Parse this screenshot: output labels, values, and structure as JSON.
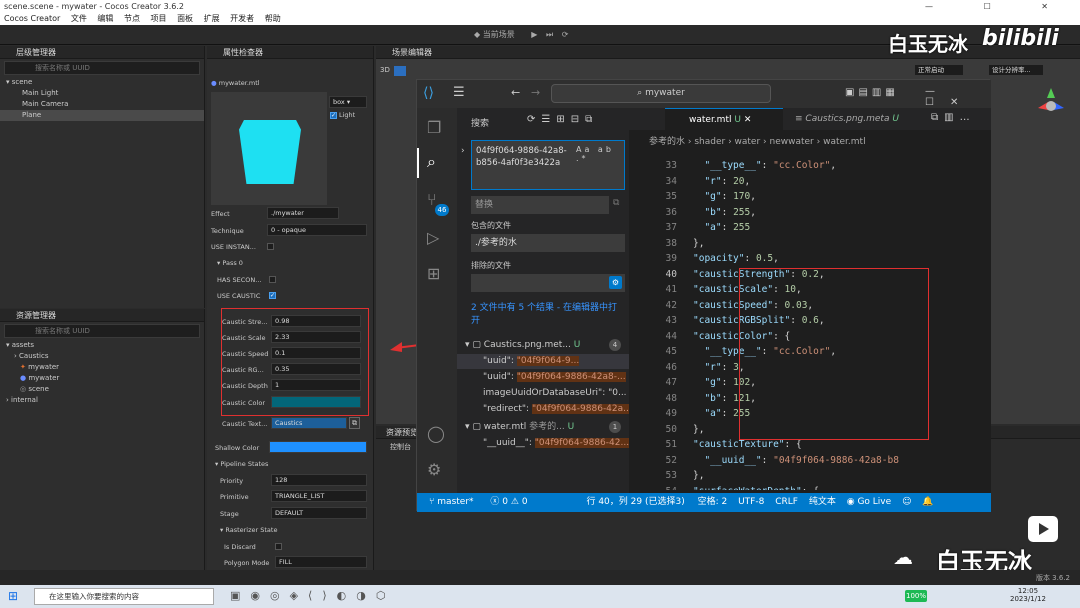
{
  "window": {
    "title": "scene.scene - mywater - Cocos Creator 3.6.2",
    "menu": [
      "Cocos Creator",
      "文件",
      "编辑",
      "节点",
      "项目",
      "面板",
      "扩展",
      "开发者",
      "帮助"
    ],
    "scene_selector": "当前场景"
  },
  "hierarchy": {
    "title": "层级管理器",
    "search_placeholder": "搜索名称或 UUID",
    "items": [
      "scene",
      "Main Light",
      "Main Camera",
      "Plane"
    ]
  },
  "assets": {
    "title": "资源管理器",
    "search_placeholder": "搜索名称或 UUID",
    "items": [
      "assets",
      "Caustics",
      "mywater",
      "mywater",
      "scene",
      "internal"
    ]
  },
  "inspector": {
    "title": "属性检查器",
    "file": "mywater.mtl",
    "preview_shape": "box",
    "light_label": "Light",
    "effect_label": "Effect",
    "effect_value": "./mywater",
    "technique_label": "Technique",
    "technique_value": "0 - opaque",
    "use_instancing": "USE INSTAN...",
    "pass_label": "Pass 0",
    "has_second": "HAS SECON...",
    "use_caustic": "USE CAUSTIC",
    "props": [
      {
        "label": "Caustic Stre...",
        "value": "0.98"
      },
      {
        "label": "Caustic Scale",
        "value": "2.33"
      },
      {
        "label": "Caustic Speed",
        "value": "0.1"
      },
      {
        "label": "Caustic RG...",
        "value": "0.35"
      },
      {
        "label": "Caustic Depth",
        "value": "1"
      },
      {
        "label": "Caustic Color",
        "value": ""
      },
      {
        "label": "Caustic Text...",
        "value": "Caustics"
      }
    ],
    "shallow_color": "Shallow Color",
    "pipeline_states": "Pipeline States",
    "priority_label": "Priority",
    "priority_value": "128",
    "primitive_label": "Primitive",
    "primitive_value": "TRIANGLE_LIST",
    "stage_label": "Stage",
    "stage_value": "DEFAULT",
    "rasterizer": "Rasterizer State",
    "is_discard": "Is Discard",
    "polygon_mode": "Polygon Mode",
    "polygon_value": "FILL"
  },
  "scene_editor": {
    "title": "场景编辑器",
    "mode_3d": "3D",
    "projection": "正常启动",
    "design": "设计分辨率..."
  },
  "console": {
    "title": "资源预览",
    "sub": "控制台"
  },
  "vscode": {
    "search_title": "搜索",
    "search_query": "04f9f064-9886-42a8-b856-4af0f3e3422a",
    "replace_placeholder": "替换",
    "include_label": "包含的文件",
    "include_value": "./参考的水",
    "exclude_label": "排除的文件",
    "result_summary": "2 文件中有 5 个结果 - 在编辑器中打开",
    "address": "mywater",
    "tabs": [
      "water.mtl",
      "Caustics.png.meta"
    ],
    "tab_badges": [
      "U",
      "U"
    ],
    "breadcrumb": [
      "参考的水",
      "shader",
      "water",
      "newwater",
      "water.mtl"
    ],
    "source_control_badge": "46",
    "results": [
      {
        "file": "Caustics.png.met...",
        "badge_letter": "U",
        "count": "4",
        "matches": [
          {
            "key": "\"uuid\": ",
            "value": "\"04f9f064-9..."
          },
          {
            "key": "\"uuid\": ",
            "value": "\"04f9f064-9886-42a8-..."
          },
          {
            "key": "imageUuidOrDatabaseUri\": ",
            "value": "\"0..."
          },
          {
            "key": "\"redirect\": ",
            "value": "\"04f9f064-9886-42a..."
          }
        ]
      },
      {
        "file": "water.mtl",
        "folder": "参考的...",
        "badge_letter": "U",
        "count": "1",
        "matches": [
          {
            "key": "\"__uuid__\": ",
            "value": "\"04f9f064-9886-42..."
          }
        ]
      }
    ],
    "code_lines": [
      {
        "n": "33",
        "text": "  \"__type__\": \"cc.Color\","
      },
      {
        "n": "34",
        "text": "  \"r\": 20,"
      },
      {
        "n": "35",
        "text": "  \"g\": 170,"
      },
      {
        "n": "36",
        "text": "  \"b\": 255,"
      },
      {
        "n": "37",
        "text": "  \"a\": 255"
      },
      {
        "n": "38",
        "text": "},"
      },
      {
        "n": "39",
        "text": "\"opacity\": 0.5,"
      },
      {
        "n": "40",
        "text": "\"causticStrength\": 0.2,"
      },
      {
        "n": "41",
        "text": "\"causticScale\": 10,"
      },
      {
        "n": "42",
        "text": "\"causticSpeed\": 0.03,"
      },
      {
        "n": "43",
        "text": "\"causticRGBSplit\": 0.6,"
      },
      {
        "n": "44",
        "text": "\"causticColor\": {"
      },
      {
        "n": "45",
        "text": "  \"__type__\": \"cc.Color\","
      },
      {
        "n": "46",
        "text": "  \"r\": 3,"
      },
      {
        "n": "47",
        "text": "  \"g\": 102,"
      },
      {
        "n": "48",
        "text": "  \"b\": 121,"
      },
      {
        "n": "49",
        "text": "  \"a\": 255"
      },
      {
        "n": "50",
        "text": "},"
      },
      {
        "n": "51",
        "text": "\"causticTexture\": {"
      },
      {
        "n": "52",
        "text": "  \"__uuid__\": \"04f9f064-9886-42a8-b8"
      },
      {
        "n": "53",
        "text": "},"
      },
      {
        "n": "54",
        "text": "\"surfaceWaterDepth\": {"
      }
    ],
    "status": {
      "branch": "master*",
      "errors": "0",
      "warnings": "0",
      "position": "行 40，列 29 (已选择3)",
      "spaces": "空格: 2",
      "encoding": "UTF-8",
      "eol": "CRLF",
      "language": "纯文本",
      "golive": "Go Live"
    }
  },
  "watermark": {
    "top": "白玉无冰",
    "brand": "bilibili",
    "bottom": "白玉无冰"
  },
  "taskbar": {
    "search_placeholder": "在这里输入你要搜索的内容",
    "battery": "100%",
    "time": "12:05",
    "date": "2023/1/12",
    "version": "版本 3.6.2"
  },
  "colors": {
    "accent": "#007acc",
    "caustic_color": "#036679",
    "shallow_color": "#1e90ff",
    "highlight_box": "#e03030"
  }
}
